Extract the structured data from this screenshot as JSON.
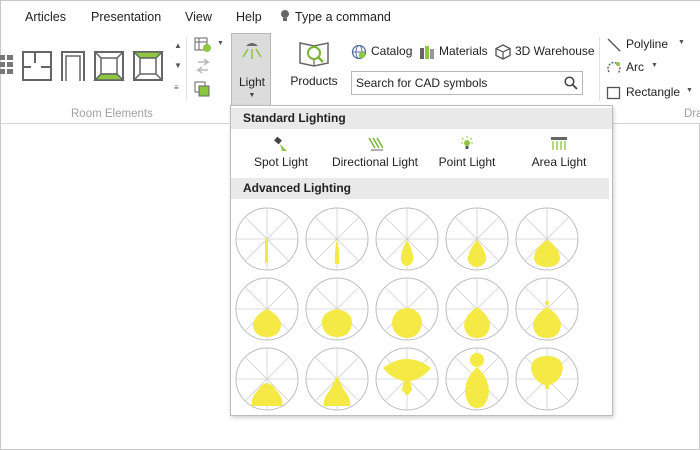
{
  "menu": {
    "items": [
      "Articles",
      "Presentation",
      "View",
      "Help"
    ],
    "command_hint": "Type a command"
  },
  "ribbon": {
    "light_label": "Light",
    "products_label": "Products",
    "catalog_label": "Catalog",
    "materials_label": "Materials",
    "warehouse_label": "3D Warehouse",
    "search_placeholder": "Search for CAD symbols",
    "room_elements_label": "Room Elements",
    "draw_label": "Dra",
    "polyline_label": "Polyline",
    "arc_label": "Arc",
    "rectangle_label": "Rectangle"
  },
  "dropdown": {
    "standard_header": "Standard Lighting",
    "standard_items": [
      "Spot Light",
      "Directional Light",
      "Point Light",
      "Area Light"
    ],
    "advanced_header": "Advanced Lighting",
    "advanced_count": 15
  },
  "colors": {
    "accent_green": "#8dc63f",
    "light_yellow": "#f5e945",
    "selected_button": "#dcdcdc"
  }
}
